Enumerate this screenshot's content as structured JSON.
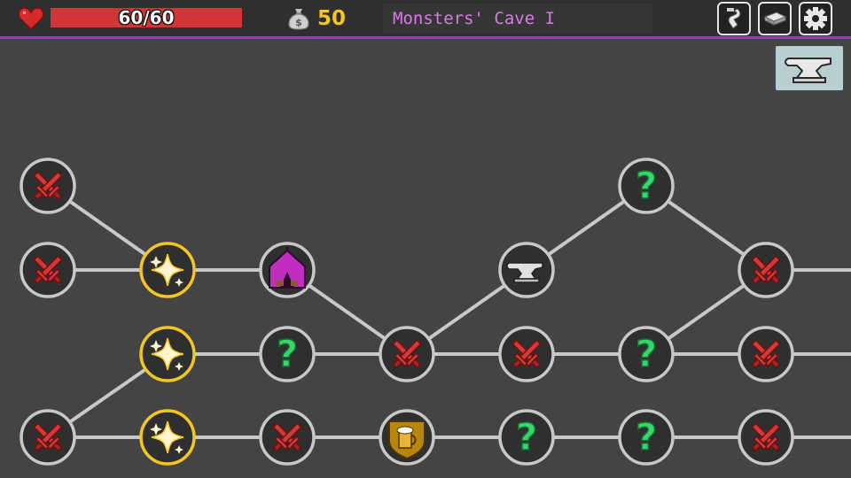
{
  "hud": {
    "hp_text": "60/60",
    "hp_fraction": 1.0,
    "gold": "50",
    "location": "Monsters' Cave I"
  },
  "icons": {
    "heart": "heart-icon",
    "money": "money-bag-icon",
    "buttons": [
      "hook-icon",
      "book-icon",
      "gear-icon"
    ],
    "forge": "anvil-icon"
  },
  "colors": {
    "accent": "#b12fb0",
    "gold": "#f3c623",
    "location_text": "#d97be6",
    "hp_fill": "#d13636",
    "node_ring": "#c8c8c8",
    "visited_ring": "#f3c623",
    "path": "#c8c8c8"
  },
  "map": {
    "columns": [
      [
        "battle",
        "battle",
        "battle"
      ],
      [
        "treasure",
        "treasure",
        "treasure"
      ],
      [
        "camp",
        "unknown",
        "battle"
      ],
      [
        "battle",
        "tavern"
      ],
      [
        "forge",
        "battle",
        "unknown"
      ],
      [
        "unknown",
        "unknown",
        "unknown"
      ],
      [
        "battle",
        "battle",
        "battle"
      ]
    ],
    "visited": [
      [
        1,
        0
      ],
      [
        1,
        1
      ],
      [
        1,
        2
      ]
    ]
  }
}
